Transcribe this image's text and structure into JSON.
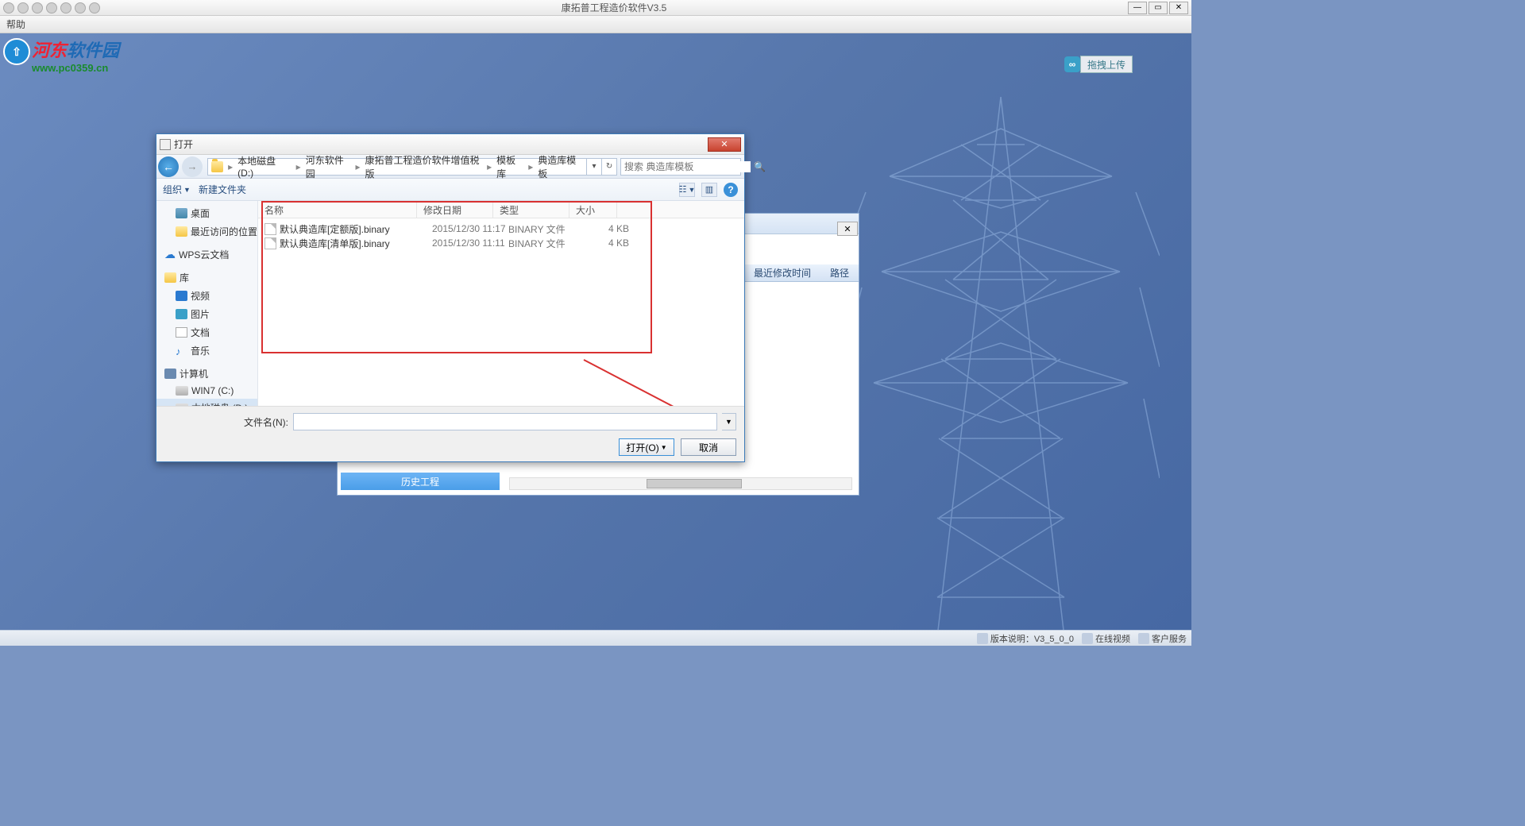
{
  "app": {
    "title": "康拓普工程造价软件V3.5",
    "menu": {
      "help": "帮助"
    },
    "upload_btn": "拖拽上传",
    "watermark": {
      "line1a": "河东",
      "line1b": "软件园",
      "line2": "www.pc0359.cn"
    }
  },
  "back_panel": {
    "columns": {
      "mtime": "最近修改时间",
      "path": "路径"
    },
    "history_btn": "历史工程"
  },
  "dialog": {
    "title": "打开",
    "breadcrumb": [
      "本地磁盘 (D:)",
      "河东软件园",
      "康拓普工程造价软件增值税版",
      "模板库",
      "典造库模板"
    ],
    "search_placeholder": "搜索 典造库模板",
    "toolbar": {
      "organize": "组织",
      "new_folder": "新建文件夹"
    },
    "sidebar": {
      "desktop": "桌面",
      "recent": "最近访问的位置",
      "wps": "WPS云文档",
      "library": "库",
      "video": "视频",
      "pictures": "图片",
      "documents": "文档",
      "music": "音乐",
      "computer": "计算机",
      "win7": "WIN7 (C:)",
      "disk_d": "本地磁盘 (D:)"
    },
    "columns": {
      "name": "名称",
      "date": "修改日期",
      "type": "类型",
      "size": "大小"
    },
    "files": [
      {
        "name": "默认典造库[定额版].binary",
        "date": "2015/12/30 11:17",
        "type": "BINARY 文件",
        "size": "4 KB"
      },
      {
        "name": "默认典造库[清单版].binary",
        "date": "2015/12/30 11:11",
        "type": "BINARY 文件",
        "size": "4 KB"
      }
    ],
    "filename_label": "文件名(N):",
    "open_btn": "打开(O)",
    "cancel_btn": "取消"
  },
  "statusbar": {
    "version": "版本说明：V3_5_0_0",
    "online": "在线视频",
    "support": "客户服务"
  }
}
